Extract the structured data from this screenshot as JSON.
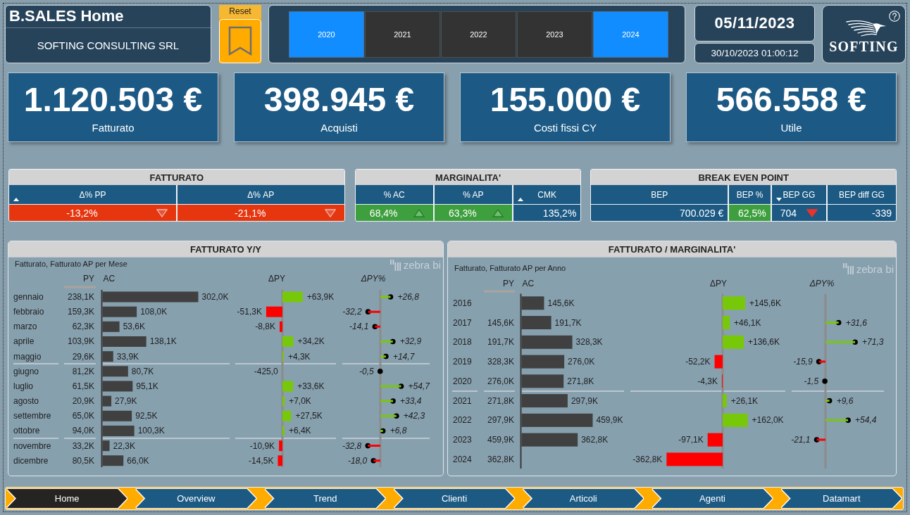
{
  "header": {
    "title": "B.SALES Home",
    "company": "SOFTING CONSULTING SRL"
  },
  "reset_button": {
    "label": "Reset"
  },
  "year_slicer": [
    {
      "label": "2020",
      "selected": true
    },
    {
      "label": "2021",
      "selected": false
    },
    {
      "label": "2022",
      "selected": false
    },
    {
      "label": "2023",
      "selected": false
    },
    {
      "label": "2024",
      "selected": true
    }
  ],
  "date": "05/11/2023",
  "last_refresh": "30/10/2023 01:00:12",
  "logo": {
    "text": "SOFTING"
  },
  "kpis": [
    {
      "value": "1.120.503 €",
      "label": "Fatturato"
    },
    {
      "value": "398.945 €",
      "label": "Acquisti"
    },
    {
      "value": "155.000 €",
      "label": "Costi fissi CY"
    },
    {
      "value": "566.558 €",
      "label": "Utile"
    }
  ],
  "tables": [
    {
      "title": "FATTURATO",
      "columns": [
        {
          "label": "Δ% PP",
          "kind": "ascending"
        },
        {
          "label": "Δ% AP",
          "kind": "plain"
        }
      ],
      "cells": [
        {
          "value": "-13,2%",
          "color": "#e5360f",
          "kind": "down"
        },
        {
          "value": "-21,1%",
          "color": "#e5360f",
          "kind": "down"
        }
      ]
    },
    {
      "title": "MARGINALITA'",
      "columns": [
        {
          "label": "% AC",
          "kind": "plain"
        },
        {
          "label": "% AP",
          "kind": "plain"
        },
        {
          "label": "CMK",
          "kind": "ascending"
        }
      ],
      "cells": [
        {
          "value": "68,4%",
          "color": "#3d9f3d",
          "kind": "up"
        },
        {
          "value": "63,3%",
          "color": "#3d9f3d",
          "kind": "up"
        },
        {
          "value": "135,2%",
          "color": "#1c5a84",
          "kind": "plain"
        }
      ]
    },
    {
      "title": "BREAK EVEN POINT",
      "columns": [
        {
          "label": "BEP",
          "kind": "plain"
        },
        {
          "label": "BEP %",
          "kind": "plain"
        },
        {
          "label": "BEP GG",
          "kind": "descending"
        },
        {
          "label": "BEP diff GG",
          "kind": "plain"
        }
      ],
      "cells": [
        {
          "value": "700.029 €",
          "color": "#1c5a84",
          "kind": "plain"
        },
        {
          "value": "62,5%",
          "color": "#3d9f3d",
          "kind": "plain"
        },
        {
          "value": "704",
          "color": "#1c5a84",
          "kind": "warning"
        },
        {
          "value": "-339",
          "color": "#1c5a84",
          "kind": "plain"
        }
      ]
    }
  ],
  "charts": [
    {
      "title": "FATTURATO Y/Y",
      "subtitle": "Fatturato, Fatturato AP per Mese",
      "brand": "zebra bi",
      "py_column": {
        "name": "PY",
        "cells": [
          {
            "value": "238,1K"
          },
          {
            "value": "159,3K"
          },
          {
            "value": "62,3K"
          },
          {
            "value": "103,9K"
          },
          {
            "value": "29,6K"
          },
          {
            "value": "81,2K"
          },
          {
            "value": "61,5K"
          },
          {
            "value": "20,9K"
          },
          {
            "value": "65,0K"
          },
          {
            "value": "94,0K"
          },
          {
            "value": "33,2K"
          },
          {
            "value": "80,5K"
          }
        ]
      },
      "ac_chart": {
        "chart_data": {
          "type": "bar",
          "orientation": "horizontal",
          "categories": [
            "gennaio",
            "febbraio",
            "marzo",
            "aprile",
            "maggio",
            "giugno",
            "luglio",
            "agosto",
            "settembre",
            "ottobre",
            "novembre",
            "dicembre"
          ],
          "series": [
            {
              "name": "AC",
              "color": "#404040",
              "values": [
                302000,
                108000,
                53600,
                138100,
                33900,
                80700,
                95100,
                27900,
                92500,
                100300,
                22300,
                66000
              ],
              "value_labels": [
                "302,0K",
                "108,0K",
                "53,6K",
                "138,1K",
                "33,9K",
                "80,7K",
                "95,1K",
                "27,9K",
                "92,5K",
                "100,3K",
                "22,3K",
                "66,0K"
              ]
            }
          ]
        }
      },
      "delta_chart": {
        "chart_data": {
          "type": "bar",
          "orientation": "horizontal",
          "series": [
            {
              "name": "ΔPY",
              "values": [
                63900,
                -51300,
                -8800,
                34200,
                4300,
                -425,
                33600,
                7000,
                27500,
                6400,
                -10900,
                -14500
              ],
              "value_labels": [
                "+63,9K",
                "-51,3K",
                "-8,8K",
                "+34,2K",
                "+4,3K",
                "-425,0",
                "+33,6K",
                "+7,0K",
                "+27,5K",
                "+6,4K",
                "-10,9K",
                "-14,5K"
              ]
            }
          ]
        }
      },
      "delta_pct_chart": {
        "chart_data": {
          "type": "bar",
          "orientation": "horizontal",
          "series": [
            {
              "name": "ΔPY%",
              "values": [
                26.8,
                -32.2,
                -14.1,
                32.9,
                14.7,
                -0.5,
                54.7,
                33.4,
                42.3,
                6.8,
                -32.8,
                -18.0
              ],
              "value_labels": [
                "+26,8",
                "-32,2",
                "-14,1",
                "+32,9",
                "+14,7",
                "-0,5",
                "+54,7",
                "+33,4",
                "+42,3",
                "+6,8",
                "-32,8",
                "-18,0"
              ]
            }
          ]
        }
      }
    },
    {
      "title": "FATTURATO / MARGINALITA'",
      "subtitle": "Fatturato, Fatturato AP per Anno",
      "brand": "zebra bi",
      "py_column": {
        "name": "PY",
        "cells": [
          {},
          {
            "value": "145,6K"
          },
          {
            "value": "191,7K"
          },
          {
            "value": "328,3K"
          },
          {
            "value": "276,0K"
          },
          {
            "value": "271,8K"
          },
          {
            "value": "297,9K"
          },
          {
            "value": "459,9K"
          },
          {
            "value": "362,8K"
          }
        ]
      },
      "ac_chart": {
        "chart_data": {
          "type": "bar",
          "orientation": "horizontal",
          "categories": [
            "2016",
            "2017",
            "2018",
            "2019",
            "2020",
            "2021",
            "2022",
            "2023",
            "2024"
          ],
          "series": [
            {
              "name": "AC",
              "color": "#404040",
              "values": [
                145600,
                191700,
                328300,
                276000,
                271800,
                297900,
                459900,
                362800,
                null
              ],
              "value_labels": [
                "145,6K",
                "191,7K",
                "328,3K",
                "276,0K",
                "271,8K",
                "297,9K",
                "459,9K",
                "362,8K",
                null
              ]
            }
          ]
        }
      },
      "delta_chart": {
        "chart_data": {
          "type": "bar",
          "orientation": "horizontal",
          "series": [
            {
              "name": "ΔPY",
              "values": [
                145600,
                46100,
                136600,
                -52200,
                -4300,
                26100,
                162000,
                -97100,
                -362800
              ],
              "value_labels": [
                "+145,6K",
                "+46,1K",
                "+136,6K",
                "-52,2K",
                "-4,3K",
                "+26,1K",
                "+162,0K",
                "-97,1K",
                "-362,8K"
              ]
            }
          ]
        }
      },
      "delta_pct_chart": {
        "chart_data": {
          "type": "bar",
          "orientation": "horizontal",
          "series": [
            {
              "name": "ΔPY%",
              "values": [
                null,
                31.6,
                71.3,
                -15.9,
                -1.5,
                9.6,
                54.4,
                -21.1,
                null
              ],
              "value_labels": [
                null,
                "+31,6",
                "+71,3",
                "-15,9",
                "-1,5",
                "+9,6",
                "+54,4",
                "-21,1",
                null
              ]
            }
          ]
        }
      }
    }
  ],
  "nav": [
    {
      "label": "Home",
      "selected": true
    },
    {
      "label": "Overview",
      "selected": false
    },
    {
      "label": "Trend",
      "selected": false
    },
    {
      "label": "Clienti",
      "selected": false
    },
    {
      "label": "Articoli",
      "selected": false
    },
    {
      "label": "Agenti",
      "selected": false
    },
    {
      "label": "Datamart",
      "selected": false
    }
  ]
}
